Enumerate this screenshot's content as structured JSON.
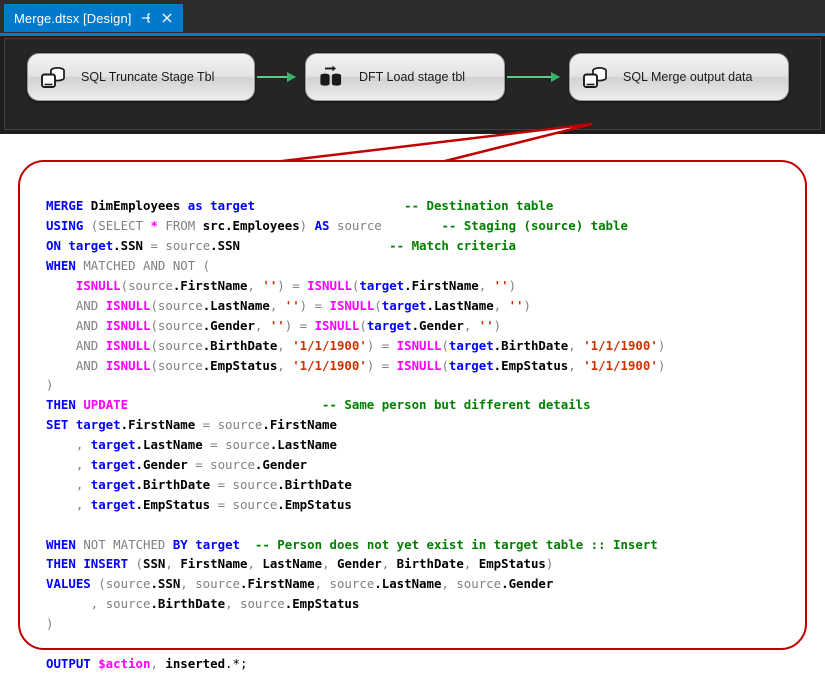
{
  "window": {
    "tab": {
      "title": "Merge.dtsx [Design]",
      "pin_icon": "pin-icon",
      "close_icon": "close-icon"
    }
  },
  "flow": {
    "tasks": [
      {
        "label": "SQL Truncate Stage Tbl",
        "icon": "execute-sql-task-icon"
      },
      {
        "label": "DFT Load stage tbl",
        "icon": "data-flow-task-icon"
      },
      {
        "label": "SQL Merge output data",
        "icon": "execute-sql-task-icon"
      }
    ],
    "connector_color": "#5cc98b"
  },
  "callout": {
    "border_color": "#c00000"
  },
  "colors": {
    "keyword": "#0000ff",
    "keyword_gray": "#808080",
    "function": "#ff00ff",
    "string": "#cc3300",
    "comment": "#008000",
    "identifier": "#000000",
    "tab_accent": "#007acc",
    "canvas": "#252526"
  },
  "code": {
    "language": "tsql",
    "lines": [
      [
        {
          "t": "MERGE ",
          "c": "kw"
        },
        {
          "t": "DimEmployees ",
          "c": "id"
        },
        {
          "t": "as ",
          "c": "kw"
        },
        {
          "t": "target",
          "c": "kw"
        },
        {
          "t": "                    ",
          "c": "op"
        },
        {
          "t": "-- Destination table",
          "c": "cm"
        }
      ],
      [
        {
          "t": "USING ",
          "c": "kw"
        },
        {
          "t": "(",
          "c": "opg"
        },
        {
          "t": "SELECT ",
          "c": "kw2"
        },
        {
          "t": "* ",
          "c": "fn"
        },
        {
          "t": "FROM ",
          "c": "kw2"
        },
        {
          "t": "src.Employees",
          "c": "id"
        },
        {
          "t": ") ",
          "c": "opg"
        },
        {
          "t": "AS ",
          "c": "kw"
        },
        {
          "t": "source",
          "c": "idm"
        },
        {
          "t": "        ",
          "c": "op"
        },
        {
          "t": "-- Staging (source) table",
          "c": "cm"
        }
      ],
      [
        {
          "t": "ON ",
          "c": "kw"
        },
        {
          "t": "target",
          "c": "kw"
        },
        {
          "t": ".SSN ",
          "c": "id"
        },
        {
          "t": "= ",
          "c": "opg"
        },
        {
          "t": "source",
          "c": "idm"
        },
        {
          "t": ".SSN",
          "c": "id"
        },
        {
          "t": "                    ",
          "c": "op"
        },
        {
          "t": "-- Match criteria",
          "c": "cm"
        }
      ],
      [
        {
          "t": "WHEN ",
          "c": "kw"
        },
        {
          "t": "MATCHED AND NOT (",
          "c": "kw2"
        }
      ],
      [
        {
          "t": "    ",
          "c": "op"
        },
        {
          "t": "ISNULL",
          "c": "fn"
        },
        {
          "t": "(",
          "c": "opg"
        },
        {
          "t": "source",
          "c": "idm"
        },
        {
          "t": ".FirstName",
          "c": "id"
        },
        {
          "t": ", ",
          "c": "opg"
        },
        {
          "t": "''",
          "c": "str"
        },
        {
          "t": ") ",
          "c": "opg"
        },
        {
          "t": "= ",
          "c": "opg"
        },
        {
          "t": "ISNULL",
          "c": "fn"
        },
        {
          "t": "(",
          "c": "opg"
        },
        {
          "t": "target",
          "c": "kw"
        },
        {
          "t": ".FirstName",
          "c": "id"
        },
        {
          "t": ", ",
          "c": "opg"
        },
        {
          "t": "''",
          "c": "str"
        },
        {
          "t": ")",
          "c": "opg"
        }
      ],
      [
        {
          "t": "    ",
          "c": "op"
        },
        {
          "t": "AND ",
          "c": "kw2"
        },
        {
          "t": "ISNULL",
          "c": "fn"
        },
        {
          "t": "(",
          "c": "opg"
        },
        {
          "t": "source",
          "c": "idm"
        },
        {
          "t": ".LastName",
          "c": "id"
        },
        {
          "t": ", ",
          "c": "opg"
        },
        {
          "t": "''",
          "c": "str"
        },
        {
          "t": ") ",
          "c": "opg"
        },
        {
          "t": "= ",
          "c": "opg"
        },
        {
          "t": "ISNULL",
          "c": "fn"
        },
        {
          "t": "(",
          "c": "opg"
        },
        {
          "t": "target",
          "c": "kw"
        },
        {
          "t": ".LastName",
          "c": "id"
        },
        {
          "t": ", ",
          "c": "opg"
        },
        {
          "t": "''",
          "c": "str"
        },
        {
          "t": ")",
          "c": "opg"
        }
      ],
      [
        {
          "t": "    ",
          "c": "op"
        },
        {
          "t": "AND ",
          "c": "kw2"
        },
        {
          "t": "ISNULL",
          "c": "fn"
        },
        {
          "t": "(",
          "c": "opg"
        },
        {
          "t": "source",
          "c": "idm"
        },
        {
          "t": ".Gender",
          "c": "id"
        },
        {
          "t": ", ",
          "c": "opg"
        },
        {
          "t": "''",
          "c": "str"
        },
        {
          "t": ") ",
          "c": "opg"
        },
        {
          "t": "= ",
          "c": "opg"
        },
        {
          "t": "ISNULL",
          "c": "fn"
        },
        {
          "t": "(",
          "c": "opg"
        },
        {
          "t": "target",
          "c": "kw"
        },
        {
          "t": ".Gender",
          "c": "id"
        },
        {
          "t": ", ",
          "c": "opg"
        },
        {
          "t": "''",
          "c": "str"
        },
        {
          "t": ")",
          "c": "opg"
        }
      ],
      [
        {
          "t": "    ",
          "c": "op"
        },
        {
          "t": "AND ",
          "c": "kw2"
        },
        {
          "t": "ISNULL",
          "c": "fn"
        },
        {
          "t": "(",
          "c": "opg"
        },
        {
          "t": "source",
          "c": "idm"
        },
        {
          "t": ".BirthDate",
          "c": "id"
        },
        {
          "t": ", ",
          "c": "opg"
        },
        {
          "t": "'1/1/1900'",
          "c": "str"
        },
        {
          "t": ") ",
          "c": "opg"
        },
        {
          "t": "= ",
          "c": "opg"
        },
        {
          "t": "ISNULL",
          "c": "fn"
        },
        {
          "t": "(",
          "c": "opg"
        },
        {
          "t": "target",
          "c": "kw"
        },
        {
          "t": ".BirthDate",
          "c": "id"
        },
        {
          "t": ", ",
          "c": "opg"
        },
        {
          "t": "'1/1/1900'",
          "c": "str"
        },
        {
          "t": ")",
          "c": "opg"
        }
      ],
      [
        {
          "t": "    ",
          "c": "op"
        },
        {
          "t": "AND ",
          "c": "kw2"
        },
        {
          "t": "ISNULL",
          "c": "fn"
        },
        {
          "t": "(",
          "c": "opg"
        },
        {
          "t": "source",
          "c": "idm"
        },
        {
          "t": ".EmpStatus",
          "c": "id"
        },
        {
          "t": ", ",
          "c": "opg"
        },
        {
          "t": "'1/1/1900'",
          "c": "str"
        },
        {
          "t": ") ",
          "c": "opg"
        },
        {
          "t": "= ",
          "c": "opg"
        },
        {
          "t": "ISNULL",
          "c": "fn"
        },
        {
          "t": "(",
          "c": "opg"
        },
        {
          "t": "target",
          "c": "kw"
        },
        {
          "t": ".EmpStatus",
          "c": "id"
        },
        {
          "t": ", ",
          "c": "opg"
        },
        {
          "t": "'1/1/1900'",
          "c": "str"
        },
        {
          "t": ")",
          "c": "opg"
        }
      ],
      [
        {
          "t": ")",
          "c": "opg"
        }
      ],
      [
        {
          "t": "THEN ",
          "c": "kw"
        },
        {
          "t": "UPDATE",
          "c": "fn"
        },
        {
          "t": "                          ",
          "c": "op"
        },
        {
          "t": "-- Same person but different details",
          "c": "cm"
        }
      ],
      [
        {
          "t": "SET ",
          "c": "kw"
        },
        {
          "t": "target",
          "c": "kw"
        },
        {
          "t": ".FirstName ",
          "c": "id"
        },
        {
          "t": "= ",
          "c": "opg"
        },
        {
          "t": "source",
          "c": "idm"
        },
        {
          "t": ".FirstName",
          "c": "id"
        }
      ],
      [
        {
          "t": "    , ",
          "c": "opg"
        },
        {
          "t": "target",
          "c": "kw"
        },
        {
          "t": ".LastName ",
          "c": "id"
        },
        {
          "t": "= ",
          "c": "opg"
        },
        {
          "t": "source",
          "c": "idm"
        },
        {
          "t": ".LastName",
          "c": "id"
        }
      ],
      [
        {
          "t": "    , ",
          "c": "opg"
        },
        {
          "t": "target",
          "c": "kw"
        },
        {
          "t": ".Gender ",
          "c": "id"
        },
        {
          "t": "= ",
          "c": "opg"
        },
        {
          "t": "source",
          "c": "idm"
        },
        {
          "t": ".Gender",
          "c": "id"
        }
      ],
      [
        {
          "t": "    , ",
          "c": "opg"
        },
        {
          "t": "target",
          "c": "kw"
        },
        {
          "t": ".BirthDate ",
          "c": "id"
        },
        {
          "t": "= ",
          "c": "opg"
        },
        {
          "t": "source",
          "c": "idm"
        },
        {
          "t": ".BirthDate",
          "c": "id"
        }
      ],
      [
        {
          "t": "    , ",
          "c": "opg"
        },
        {
          "t": "target",
          "c": "kw"
        },
        {
          "t": ".EmpStatus ",
          "c": "id"
        },
        {
          "t": "= ",
          "c": "opg"
        },
        {
          "t": "source",
          "c": "idm"
        },
        {
          "t": ".EmpStatus",
          "c": "id"
        }
      ],
      [
        {
          "t": "",
          "c": "op"
        }
      ],
      [
        {
          "t": "WHEN ",
          "c": "kw"
        },
        {
          "t": "NOT MATCHED ",
          "c": "kw2"
        },
        {
          "t": "BY ",
          "c": "kw"
        },
        {
          "t": "target",
          "c": "kw"
        },
        {
          "t": "  ",
          "c": "op"
        },
        {
          "t": "-- Person does not yet exist in target table :: Insert",
          "c": "cm"
        }
      ],
      [
        {
          "t": "THEN ",
          "c": "kw"
        },
        {
          "t": "INSERT ",
          "c": "kw"
        },
        {
          "t": "(",
          "c": "opg"
        },
        {
          "t": "SSN",
          "c": "id"
        },
        {
          "t": ", ",
          "c": "opg"
        },
        {
          "t": "FirstName",
          "c": "id"
        },
        {
          "t": ", ",
          "c": "opg"
        },
        {
          "t": "LastName",
          "c": "id"
        },
        {
          "t": ", ",
          "c": "opg"
        },
        {
          "t": "Gender",
          "c": "id"
        },
        {
          "t": ", ",
          "c": "opg"
        },
        {
          "t": "BirthDate",
          "c": "id"
        },
        {
          "t": ", ",
          "c": "opg"
        },
        {
          "t": "EmpStatus",
          "c": "id"
        },
        {
          "t": ")",
          "c": "opg"
        }
      ],
      [
        {
          "t": "VALUES ",
          "c": "kw"
        },
        {
          "t": "(",
          "c": "opg"
        },
        {
          "t": "source",
          "c": "idm"
        },
        {
          "t": ".SSN",
          "c": "id"
        },
        {
          "t": ", ",
          "c": "opg"
        },
        {
          "t": "source",
          "c": "idm"
        },
        {
          "t": ".FirstName",
          "c": "id"
        },
        {
          "t": ", ",
          "c": "opg"
        },
        {
          "t": "source",
          "c": "idm"
        },
        {
          "t": ".LastName",
          "c": "id"
        },
        {
          "t": ", ",
          "c": "opg"
        },
        {
          "t": "source",
          "c": "idm"
        },
        {
          "t": ".Gender",
          "c": "id"
        }
      ],
      [
        {
          "t": "      , ",
          "c": "opg"
        },
        {
          "t": "source",
          "c": "idm"
        },
        {
          "t": ".BirthDate",
          "c": "id"
        },
        {
          "t": ", ",
          "c": "opg"
        },
        {
          "t": "source",
          "c": "idm"
        },
        {
          "t": ".EmpStatus",
          "c": "id"
        }
      ],
      [
        {
          "t": ")",
          "c": "opg"
        }
      ],
      [
        {
          "t": "",
          "c": "op"
        }
      ],
      [
        {
          "t": "OUTPUT ",
          "c": "kw"
        },
        {
          "t": "$action",
          "c": "fn"
        },
        {
          "t": ", ",
          "c": "opg"
        },
        {
          "t": "inserted",
          "c": "id"
        },
        {
          "t": ".*;",
          "c": "op"
        }
      ]
    ]
  }
}
